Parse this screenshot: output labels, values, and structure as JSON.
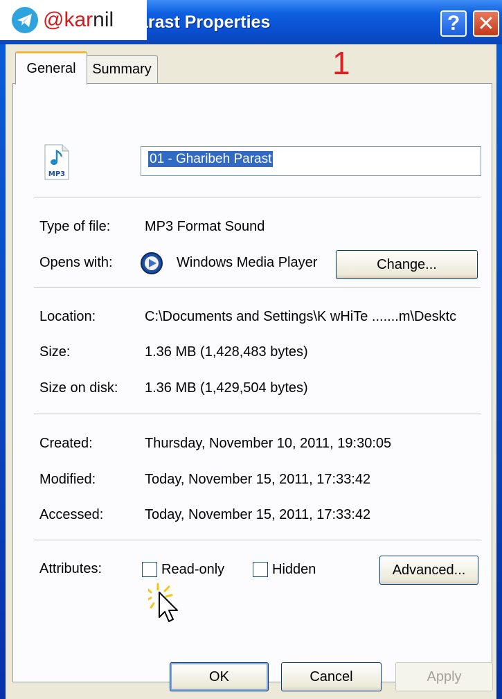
{
  "window": {
    "title": "arast Properties",
    "help_glyph": "?",
    "close_glyph": "✕"
  },
  "watermark": {
    "prefix": "@kar",
    "suffix": "nil"
  },
  "annotation_number": "1",
  "tabs": [
    {
      "label": "General"
    },
    {
      "label": "Summary"
    }
  ],
  "general": {
    "file_icon_label": "MP3",
    "file_name": "01 - Gharibeh Parast",
    "type_label": "Type of file:",
    "type_value": "MP3 Format Sound",
    "opens_label": "Opens with:",
    "opens_value": "Windows Media Player",
    "change_label": "Change...",
    "location_label": "Location:",
    "location_value": "C:\\Documents and Settings\\K wHiTe .......m\\Desktc",
    "size_label": "Size:",
    "size_value": "1.36 MB (1,428,483 bytes)",
    "size_disk_label": "Size on disk:",
    "size_disk_value": "1.36 MB (1,429,504 bytes)",
    "created_label": "Created:",
    "created_value": "Thursday, November 10, 2011, 19:30:05",
    "modified_label": "Modified:",
    "modified_value": "Today, November 15, 2011, 17:33:42",
    "accessed_label": "Accessed:",
    "accessed_value": "Today, November 15, 2011, 17:33:42",
    "attributes_label": "Attributes:",
    "readonly_label": "Read-only",
    "readonly_checked": false,
    "hidden_label": "Hidden",
    "hidden_checked": false,
    "advanced_label": "Advanced..."
  },
  "footer": {
    "ok_label": "OK",
    "cancel_label": "Cancel",
    "apply_label": "Apply"
  },
  "colors": {
    "title_bar": "#0a4fcf",
    "selection": "#316ac5",
    "tab_highlight": "#f4b73e",
    "annotation_red": "#e02020"
  }
}
